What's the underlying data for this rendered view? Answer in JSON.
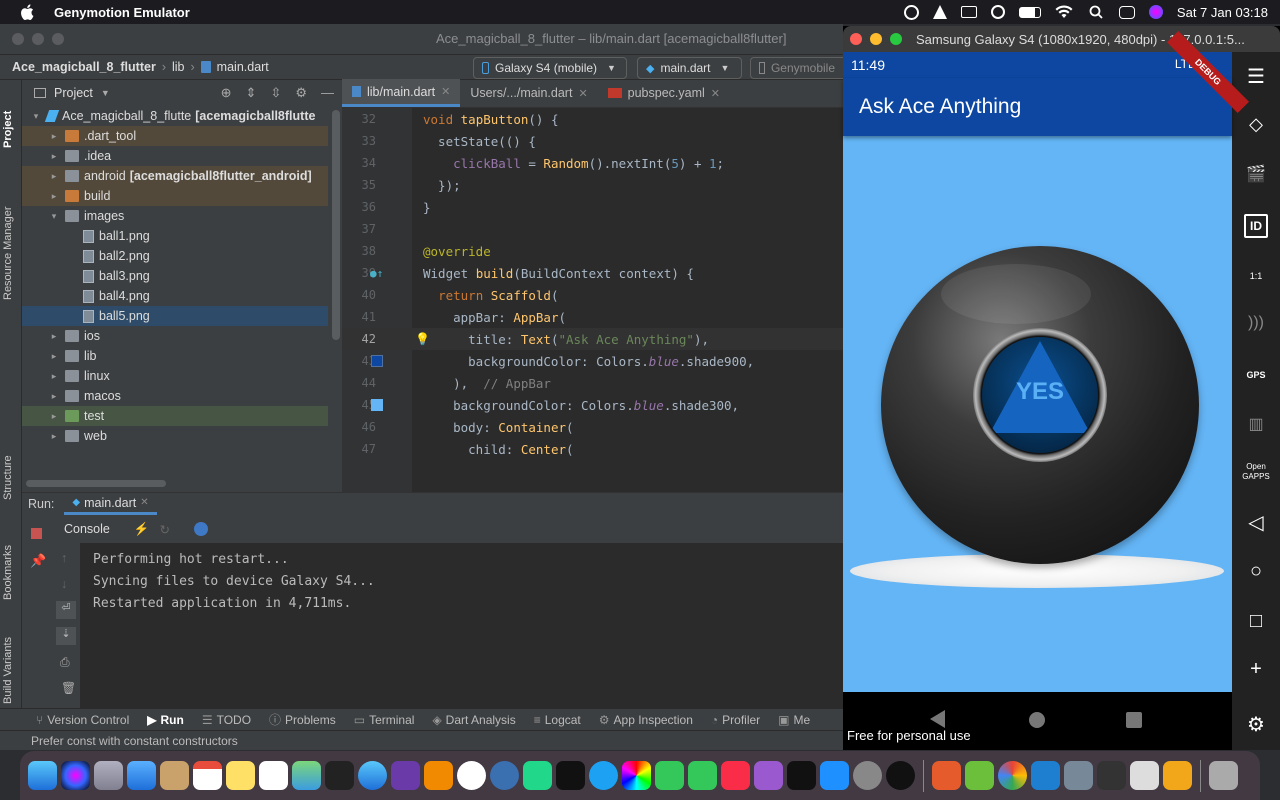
{
  "menubar": {
    "app_name": "Genymotion Emulator",
    "clock": "Sat 7 Jan  03:18"
  },
  "ide": {
    "window_title": "Ace_magicball_8_flutter – lib/main.dart [acemagicball8flutter]",
    "breadcrumb": [
      "Ace_magicball_8_flutter",
      "lib",
      "main.dart"
    ],
    "device_selector": "Galaxy S4 (mobile)",
    "run_config": "main.dart",
    "genymotion_btn": "Genymobile",
    "side_tabs": [
      "Project",
      "Resource Manager",
      "Structure",
      "Bookmarks",
      "Build Variants"
    ],
    "project_panel_title": "Project",
    "tree": [
      {
        "label": "Ace_magicball_8_flutte",
        "extra": "[acemagicball8flutte",
        "indent": 0,
        "arrow": "▾",
        "icon": "flutter"
      },
      {
        "label": ".dart_tool",
        "extra": "",
        "indent": 1,
        "arrow": "▸",
        "icon": "folder-orange"
      },
      {
        "label": ".idea",
        "extra": "",
        "indent": 1,
        "arrow": "▸",
        "icon": "folder"
      },
      {
        "label": "android",
        "extra": "[acemagicball8flutter_android]",
        "indent": 1,
        "arrow": "▸",
        "icon": "folder"
      },
      {
        "label": "build",
        "extra": "",
        "indent": 1,
        "arrow": "▸",
        "icon": "folder-orange"
      },
      {
        "label": "images",
        "extra": "",
        "indent": 1,
        "arrow": "▾",
        "icon": "folder"
      },
      {
        "label": "ball1.png",
        "extra": "",
        "indent": 2,
        "arrow": "",
        "icon": "png"
      },
      {
        "label": "ball2.png",
        "extra": "",
        "indent": 2,
        "arrow": "",
        "icon": "png"
      },
      {
        "label": "ball3.png",
        "extra": "",
        "indent": 2,
        "arrow": "",
        "icon": "png"
      },
      {
        "label": "ball4.png",
        "extra": "",
        "indent": 2,
        "arrow": "",
        "icon": "png"
      },
      {
        "label": "ball5.png",
        "extra": "",
        "indent": 2,
        "arrow": "",
        "icon": "png"
      },
      {
        "label": "ios",
        "extra": "",
        "indent": 1,
        "arrow": "▸",
        "icon": "folder"
      },
      {
        "label": "lib",
        "extra": "",
        "indent": 1,
        "arrow": "▸",
        "icon": "folder"
      },
      {
        "label": "linux",
        "extra": "",
        "indent": 1,
        "arrow": "▸",
        "icon": "folder"
      },
      {
        "label": "macos",
        "extra": "",
        "indent": 1,
        "arrow": "▸",
        "icon": "folder"
      },
      {
        "label": "test",
        "extra": "",
        "indent": 1,
        "arrow": "▸",
        "icon": "folder-green"
      },
      {
        "label": "web",
        "extra": "",
        "indent": 1,
        "arrow": "▸",
        "icon": "folder"
      }
    ],
    "tabs": [
      "lib/main.dart",
      "Users/.../main.dart",
      "pubspec.yaml"
    ],
    "code_line_numbers": [
      "32",
      "33",
      "34",
      "35",
      "36",
      "37",
      "38",
      "39",
      "40",
      "41",
      "42",
      "43",
      "44",
      "45",
      "46",
      "47"
    ],
    "run_panel": {
      "run_label": "Run:",
      "run_tab": "main.dart",
      "console_label": "Console",
      "output": [
        "Performing hot restart...",
        "Syncing files to device Galaxy S4...",
        "Restarted application in 4,711ms."
      ]
    },
    "bottom_tools": [
      "Version Control",
      "Run",
      "TODO",
      "Problems",
      "Terminal",
      "Dart Analysis",
      "Logcat",
      "App Inspection",
      "Profiler",
      "Me"
    ],
    "status_message": "Prefer const with constant constructors"
  },
  "emulator": {
    "window_title": "Samsung Galaxy S4 (1080x1920, 480dpi) - 127.0.0.1:5...",
    "time": "11:49",
    "network": "LTE",
    "debug_banner": "DEBUG",
    "app_title": "Ask Ace Anything",
    "answer": "YES",
    "watermark": "Free for personal use",
    "tools": [
      "menu",
      "rotate",
      "capture",
      "ID",
      "1:1",
      "cast",
      "GPS",
      "media",
      "Open GAPPS",
      "back",
      "home",
      "recents",
      "+",
      "settings"
    ]
  },
  "colors": {
    "appbar": "#0d47a1",
    "body": "#64b5f6"
  }
}
